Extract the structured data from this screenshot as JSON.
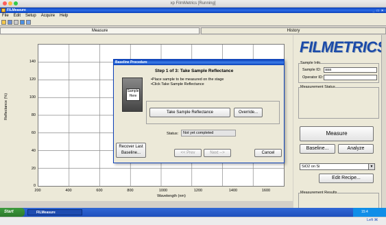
{
  "mac_window": {
    "title": "xp FilmMetrics [Running]"
  },
  "app": {
    "title": "FILMeasure",
    "window_buttons": "_ □ ×"
  },
  "menu": [
    "File",
    "Edit",
    "Setup",
    "Acquire",
    "Help"
  ],
  "tabs": {
    "measure": "Measure",
    "history": "History"
  },
  "plot": {
    "yticks": [
      "140",
      "120",
      "100",
      "80",
      "60",
      "40",
      "20",
      "0"
    ],
    "xticks": [
      "200",
      "400",
      "600",
      "800",
      "1000",
      "1200",
      "1400",
      "1600"
    ],
    "ylabel": "Reflectance (%)",
    "xlabel_line1": "Wavelength",
    "xlabel_line2": "(nm)"
  },
  "dialog": {
    "title": "Baseline Procedure",
    "step_title": "Step 1 of 3: Take Sample Reflectance",
    "instruction_1": "•Place sample to be measured on the stage",
    "instruction_2": "•Click Take Sample Reflectance",
    "sample_label_1": "Sample",
    "sample_label_2": "Here",
    "take_button": "Take Sample Reflectance",
    "override_button": "Override...",
    "status_label": "Status:",
    "status_value": "Not yet completed",
    "recover_line1": "Recover Last",
    "recover_line2": "Baseline...",
    "prev_button": "<< Prev",
    "next_button": "Next -->",
    "cancel_button": "Cancel"
  },
  "right_panel": {
    "logo": "FILMETRICS",
    "sample_info_label": "Sample Info",
    "sample_id_label": "Sample ID:",
    "sample_id_value": "aaa",
    "operator_id_label": "Operator ID:",
    "operator_id_value": "",
    "measurement_status_label": "Measurement Status",
    "measure_button": "Measure",
    "baseline_button": "Baseline...",
    "analyze_button": "Analyze",
    "recipe_select": "SiO2 on Si",
    "edit_recipe_button": "Edit Recipe...",
    "measurement_results_label": "Measurement Results"
  },
  "taskbar": {
    "start": "Start",
    "task_item": "FILMeasure",
    "tray_time": "15:4"
  },
  "host_strip": {
    "indicator": "Left ⌘"
  },
  "colors": {
    "xp_blue": "#0a3fb8",
    "logo_blue": "#1b4aa8",
    "panel_bg": "#ece9d8",
    "start_green": "#3c9a3c"
  }
}
